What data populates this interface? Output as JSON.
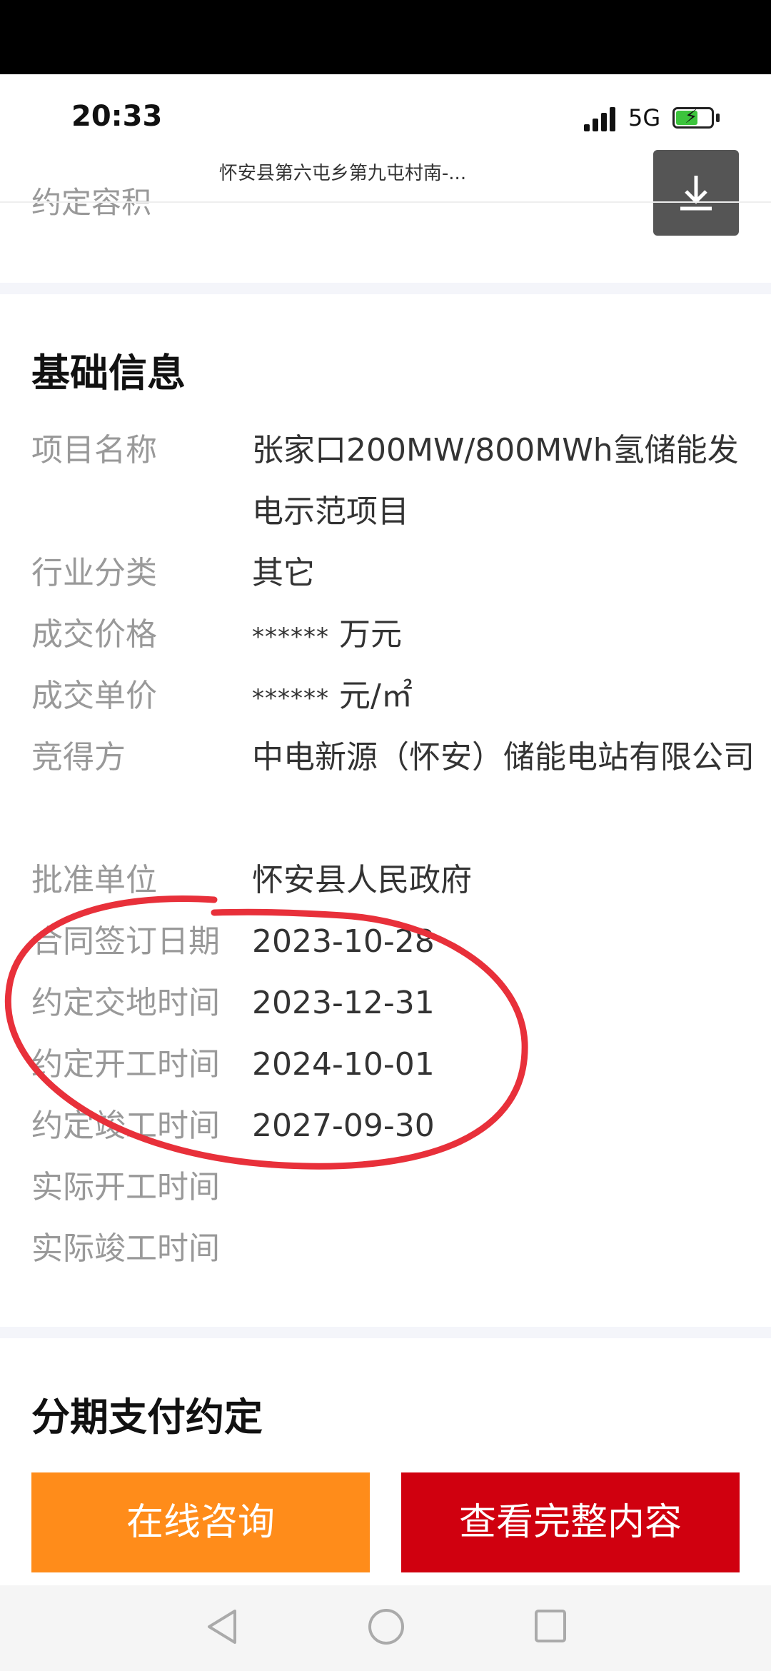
{
  "status": {
    "time": "20:33",
    "network": "5G"
  },
  "header": {
    "page_title": "怀安县第六屯乡第九屯村南-...",
    "peek_label": "约定容积"
  },
  "basic_info": {
    "title": "基础信息",
    "rows": [
      {
        "label": "项目名称",
        "value": "张家口200MW/800MWh氢储能发电示范项目"
      },
      {
        "label": "行业分类",
        "value": "其它"
      },
      {
        "label": "成交价格",
        "mask": "******",
        "value": "万元"
      },
      {
        "label": "成交单价",
        "mask": "******",
        "value": "元/㎡"
      },
      {
        "label": "竞得方",
        "value": "中电新源（怀安）储能电站有限公司"
      },
      {
        "label": "批准单位",
        "value": "怀安县人民政府"
      },
      {
        "label": "合同签订日期",
        "value": "2023-10-28"
      },
      {
        "label": "约定交地时间",
        "value": "2023-12-31"
      },
      {
        "label": "约定开工时间",
        "value": "2024-10-01"
      },
      {
        "label": "约定竣工时间",
        "value": "2027-09-30"
      },
      {
        "label": "实际开工时间",
        "value": ""
      },
      {
        "label": "实际竣工时间",
        "value": ""
      }
    ]
  },
  "installment": {
    "title": "分期支付约定"
  },
  "actions": {
    "consult_label": "在线咨询",
    "view_full_label": "查看完整内容"
  },
  "colors": {
    "consult_bg": "#ff8c1a",
    "view_full_bg": "#d0000f",
    "annotation": "#e8303a"
  },
  "icons": {
    "download": "download-icon",
    "nav_back": "nav-back-icon",
    "nav_home": "nav-home-icon",
    "nav_recent": "nav-recent-icon"
  }
}
